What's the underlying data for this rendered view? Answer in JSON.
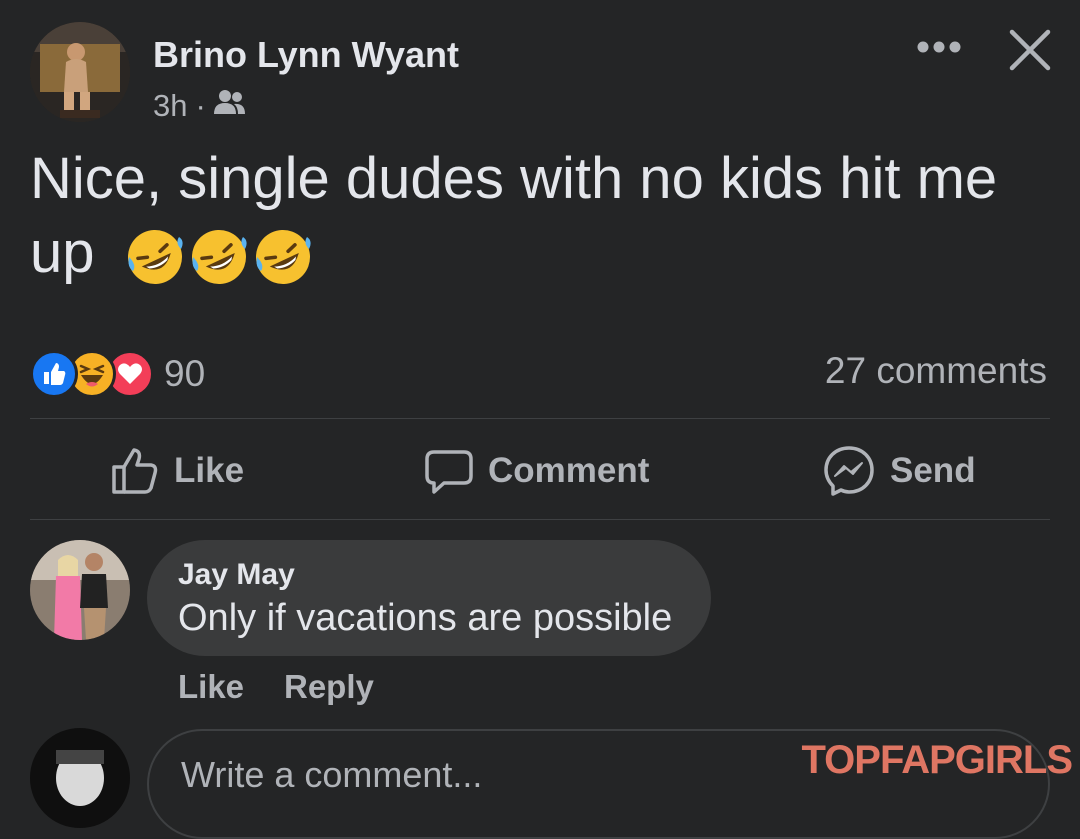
{
  "post": {
    "author": "Brino Lynn Wyant",
    "time": "3h",
    "separator": "·",
    "audience_icon": "friends-icon",
    "text": "Nice, single dudes with no kids hit me up",
    "emojis": [
      "rofl-emoji",
      "rofl-emoji",
      "rofl-emoji"
    ]
  },
  "header": {
    "more_icon": "more-dots-icon",
    "close_icon": "close-icon"
  },
  "reactions": {
    "types": [
      "like",
      "haha",
      "love"
    ],
    "count": "90",
    "comments": "27 comments"
  },
  "actions": {
    "like": "Like",
    "comment": "Comment",
    "send": "Send"
  },
  "comment": {
    "author": "Jay May",
    "text": "Only if vacations are possible",
    "like": "Like",
    "reply": "Reply"
  },
  "composer": {
    "placeholder": "Write a comment..."
  },
  "watermark": "TOPFAPGIRLS",
  "colors": {
    "background": "#242526",
    "bubble": "#3a3b3c",
    "primary_text": "#e4e6eb",
    "secondary_text": "#b0b3b8",
    "like_blue": "#1877f2",
    "love_red": "#f33e58",
    "haha_yellow": "#f7b125"
  }
}
